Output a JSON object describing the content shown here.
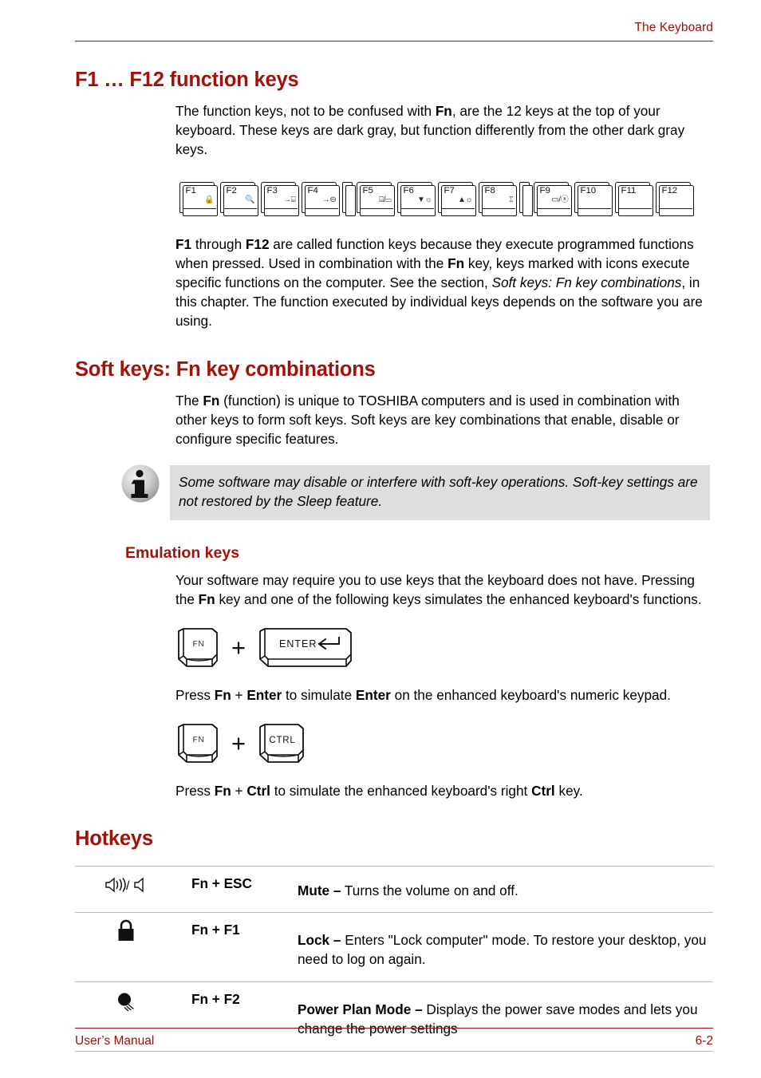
{
  "header": {
    "title": "The Keyboard"
  },
  "footer": {
    "manual": "User’s Manual",
    "page": "6-2"
  },
  "colors": {
    "heading_red": "#a3120a",
    "header_red": "#9c1006",
    "note_bg": "#dedede",
    "rule_gray": "#b6b6b6"
  },
  "sections": {
    "f1f12": {
      "heading": "F1 … F12 function keys",
      "para1_a": "The function keys, not to be confused with ",
      "para1_fn": "Fn",
      "para1_b": ", are the 12 keys at the top of your keyboard. These keys are dark gray, but function differently from the other dark gray keys.",
      "para2_f1": "F1",
      "para2_a": " through ",
      "para2_f12": "F12",
      "para2_b": " are called function keys because they execute programmed functions when pressed. Used in combination with the ",
      "para2_fn": "Fn",
      "para2_c": " key, keys marked with icons execute specific functions on the computer. See the section, ",
      "para2_italic": "Soft keys: Fn key combinations",
      "para2_d": ", in this chapter. The function executed by individual keys depends on the software you are using."
    },
    "softkeys": {
      "heading": "Soft keys: Fn key combinations",
      "para_a": "The ",
      "para_fn": "Fn",
      "para_b": " (function) is unique to TOSHIBA computers and is used in combination with other keys to form soft keys. Soft keys are key combinations that enable, disable or configure specific features.",
      "note": "Some software may disable or interfere with soft-key operations. Soft-key settings are not restored by the Sleep feature.",
      "note_icon": "info-circle-icon"
    },
    "emulation": {
      "heading": "Emulation keys",
      "para_a": "Your software may require you to use keys that the keyboard does not have. Pressing the ",
      "para_fn": "Fn",
      "para_b": " key and one of the following keys simulates the enhanced keyboard's functions.",
      "combo1": {
        "key1": "FN",
        "plus": "+",
        "key2": "ENTER",
        "key2_glyph": "enter-arrow-icon"
      },
      "caption1_a": "Press ",
      "caption1_fn": "Fn",
      "caption1_plus": " + ",
      "caption1_enter": "Enter",
      "caption1_b": " to simulate ",
      "caption1_enter2": "Enter",
      "caption1_c": " on the enhanced keyboard's numeric keypad.",
      "combo2": {
        "key1": "FN",
        "plus": "+",
        "key2": "CTRL"
      },
      "caption2_a": "Press ",
      "caption2_fn": "Fn",
      "caption2_plus": " + ",
      "caption2_ctrl": "Ctrl",
      "caption2_b": " to simulate the enhanced keyboard's right ",
      "caption2_ctrl2": "Ctrl",
      "caption2_c": " key."
    },
    "hotkeys": {
      "heading": "Hotkeys"
    }
  },
  "function_keys": [
    {
      "label": "F1",
      "glyph": "🔒",
      "icon_name": "lock-icon",
      "type": "key"
    },
    {
      "label": "F2",
      "glyph": "🔍",
      "icon_name": "magnifier-icon",
      "type": "key"
    },
    {
      "label": "F3",
      "glyph": "→⌸",
      "icon_name": "sleep-icon",
      "type": "key"
    },
    {
      "label": "F4",
      "glyph": "→⊖",
      "icon_name": "hibernate-icon",
      "type": "key"
    },
    {
      "label": "",
      "glyph": "",
      "icon_name": "narrow-spacer-key",
      "type": "gap"
    },
    {
      "label": "F5",
      "glyph": "⌸/▭",
      "icon_name": "display-switch-icon",
      "type": "key"
    },
    {
      "label": "F6",
      "glyph": "▼☼",
      "icon_name": "brightness-down-icon",
      "type": "key"
    },
    {
      "label": "F7",
      "glyph": "▲☼",
      "icon_name": "brightness-up-icon",
      "type": "key"
    },
    {
      "label": "F8",
      "glyph": "⑄",
      "icon_name": "wireless-icon",
      "type": "key"
    },
    {
      "label": "",
      "glyph": "",
      "icon_name": "narrow-spacer-key-2",
      "type": "gap"
    },
    {
      "label": "F9",
      "glyph": "▭/ⓧ",
      "icon_name": "touchpad-toggle-icon",
      "type": "key"
    },
    {
      "label": "F10",
      "glyph": "",
      "icon_name": "f10-key",
      "type": "key"
    },
    {
      "label": "F11",
      "glyph": "",
      "icon_name": "f11-key",
      "type": "key"
    },
    {
      "label": "F12",
      "glyph": "",
      "icon_name": "f12-key",
      "type": "key"
    }
  ],
  "hotkey_rows": [
    {
      "icon_name": "mute-speaker-icon",
      "combo": "Fn + ESC",
      "term": "Mute –",
      "desc": " Turns the volume on and off."
    },
    {
      "icon_name": "padlock-icon",
      "combo": "Fn + F1",
      "term": "Lock –",
      "desc": " Enters \"Lock computer\" mode. To restore your desktop, you need to log on again."
    },
    {
      "icon_name": "power-plan-icon",
      "combo": "Fn + F2",
      "term": "Power Plan Mode –",
      "desc": " Displays the power save modes and lets you change the power settings"
    }
  ]
}
